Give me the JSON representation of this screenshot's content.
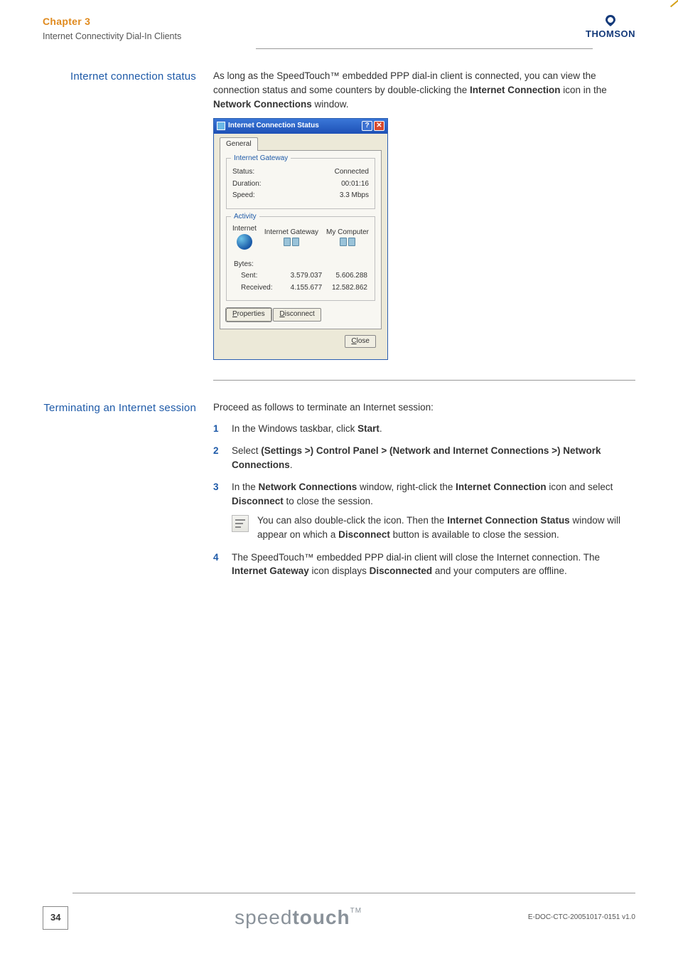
{
  "header": {
    "chapter": "Chapter 3",
    "subtitle": "Internet Connectivity Dial-In Clients",
    "brand": "THOMSON"
  },
  "section1": {
    "label": "Internet connection status",
    "para_pre": "As long as the SpeedTouch™ embedded PPP dial-in client is connected, you can view the connection status and some counters by double-clicking the ",
    "bold1": "Internet Connection",
    "para_mid": " icon in the ",
    "bold2": "Network Connections",
    "para_end": " window."
  },
  "dialog": {
    "title": "Internet Connection Status",
    "tab": "General",
    "grp1": {
      "title": "Internet Gateway",
      "rows": [
        {
          "k": "Status:",
          "v": "Connected"
        },
        {
          "k": "Duration:",
          "v": "00:01:16"
        },
        {
          "k": "Speed:",
          "v": "3.3 Mbps"
        }
      ]
    },
    "grp2": {
      "title": "Activity",
      "heads": {
        "a": "Internet",
        "b": "Internet Gateway",
        "c": "My Computer"
      },
      "bytes_label": "Bytes:",
      "sent_label": "Sent:",
      "recv_label": "Received:",
      "sent": {
        "gw": "3.579.037",
        "pc": "5.606.288"
      },
      "recv": {
        "gw": "4.155.677",
        "pc": "12.582.862"
      }
    },
    "btn_props": "Properties",
    "btn_disc": "Disconnect",
    "btn_close": "Close"
  },
  "section2": {
    "label": "Terminating an Internet session",
    "intro": "Proceed as follows to terminate an Internet session:",
    "step1_a": "In the Windows taskbar, click ",
    "step1_b": "Start",
    "step1_c": ".",
    "step2_a": "Select ",
    "step2_b": "(Settings >) Control Panel > (Network and Internet Connections >) Network Connections",
    "step2_c": ".",
    "step3_a": "In the ",
    "step3_b": "Network Connections",
    "step3_c": " window, right-click the ",
    "step3_d": "Internet Connection",
    "step3_e": " icon and select ",
    "step3_f": "Disconnect",
    "step3_g": " to close the session.",
    "note_a": "You can also double-click the icon. Then the ",
    "note_b": "Internet Connection Status",
    "note_c": " window will appear on which a ",
    "note_d": "Disconnect",
    "note_e": " button is available to close the session.",
    "step4_a": "The SpeedTouch™ embedded PPP dial-in client will close the Internet connection. The ",
    "step4_b": "Internet Gateway",
    "step4_c": " icon displays ",
    "step4_d": "Disconnected",
    "step4_e": " and your computers are offline."
  },
  "footer": {
    "page": "34",
    "product_thin": "speed",
    "product_bold": "touch",
    "tm": "TM",
    "docid": "E-DOC-CTC-20051017-0151 v1.0"
  }
}
